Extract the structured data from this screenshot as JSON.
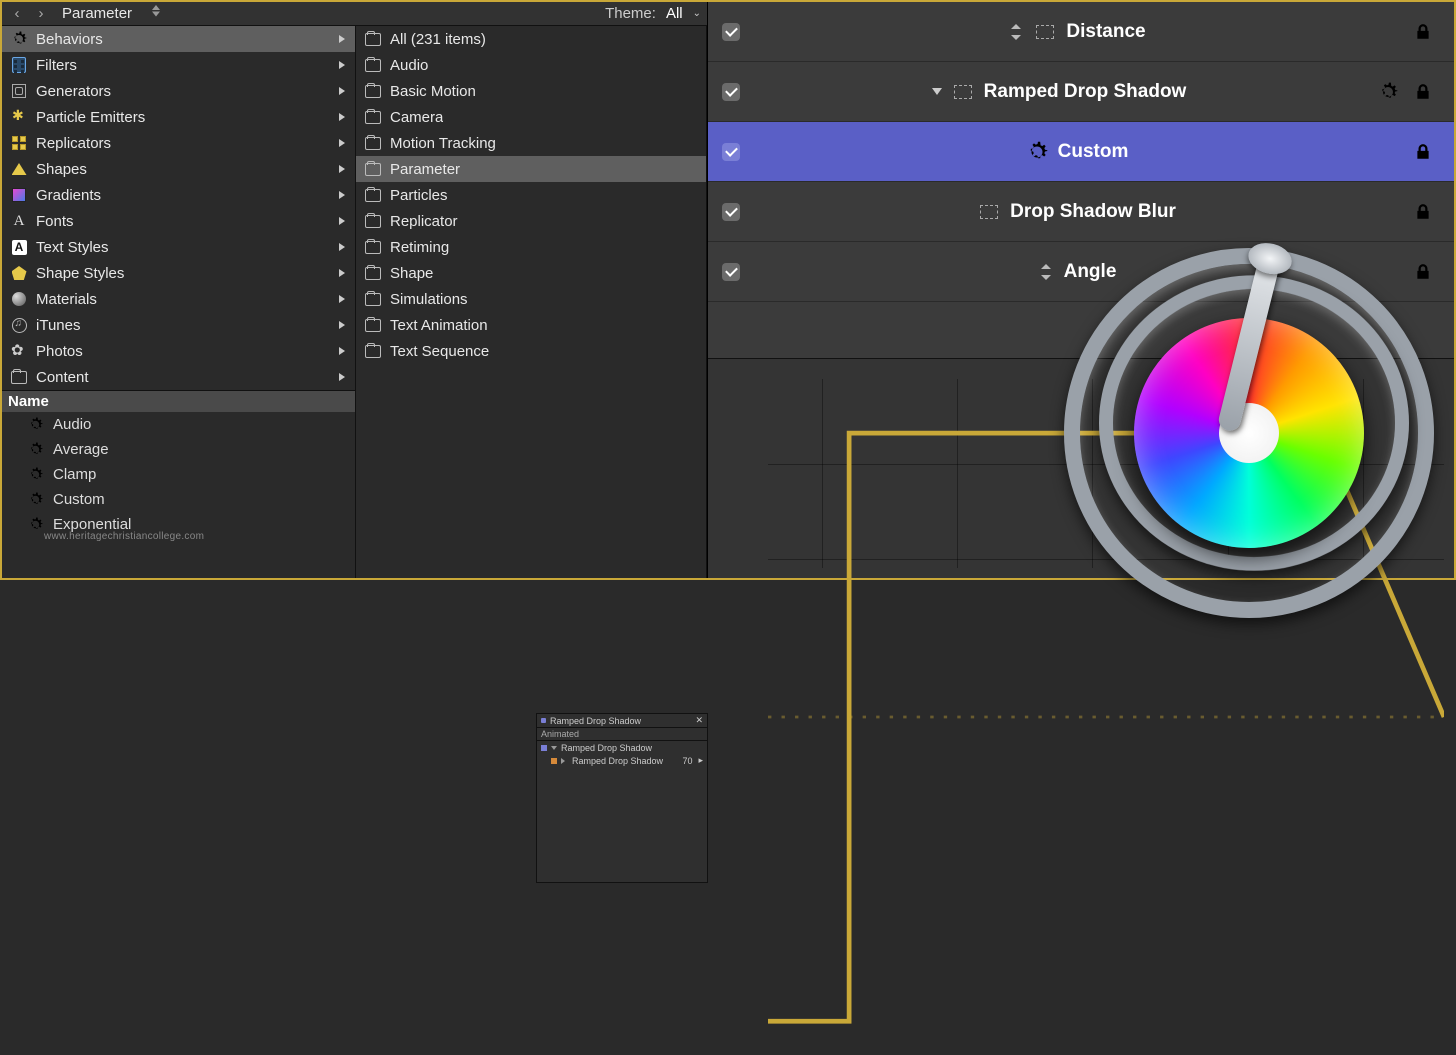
{
  "header": {
    "crumb": "Parameter",
    "theme_label": "Theme:",
    "theme_value": "All"
  },
  "categories": [
    {
      "label": "Behaviors",
      "icon": "gear",
      "selected": true
    },
    {
      "label": "Filters",
      "icon": "film"
    },
    {
      "label": "Generators",
      "icon": "gen"
    },
    {
      "label": "Particle Emitters",
      "icon": "particle"
    },
    {
      "label": "Replicators",
      "icon": "repl"
    },
    {
      "label": "Shapes",
      "icon": "shape"
    },
    {
      "label": "Gradients",
      "icon": "grad"
    },
    {
      "label": "Fonts",
      "icon": "font"
    },
    {
      "label": "Text Styles",
      "icon": "astyle"
    },
    {
      "label": "Shape Styles",
      "icon": "pent"
    },
    {
      "label": "Materials",
      "icon": "mat"
    },
    {
      "label": "iTunes",
      "icon": "itunes"
    },
    {
      "label": "Photos",
      "icon": "photos"
    },
    {
      "label": "Content",
      "icon": "folder"
    }
  ],
  "subcats": [
    {
      "label": "All (231 items)"
    },
    {
      "label": "Audio"
    },
    {
      "label": "Basic Motion"
    },
    {
      "label": "Camera"
    },
    {
      "label": "Motion Tracking"
    },
    {
      "label": "Parameter",
      "selected": true
    },
    {
      "label": "Particles"
    },
    {
      "label": "Replicator"
    },
    {
      "label": "Retiming"
    },
    {
      "label": "Shape"
    },
    {
      "label": "Simulations"
    },
    {
      "label": "Text Animation"
    },
    {
      "label": "Text Sequence"
    }
  ],
  "name_header": "Name",
  "behaviors_list": [
    "Audio",
    "Average",
    "Clamp",
    "Custom",
    "Exponential"
  ],
  "layers": [
    {
      "label": "Distance",
      "checked": true,
      "icon": "stepper",
      "thumb": "dashed"
    },
    {
      "label": "Ramped Drop Shadow",
      "checked": true,
      "icon": "disclose-down",
      "thumb": "dashed",
      "gear": true
    },
    {
      "label": "Custom",
      "checked": true,
      "selected": true,
      "icon": "gear"
    },
    {
      "label": "Drop Shadow Blur",
      "checked": true,
      "thumb": "dashed"
    },
    {
      "label": "Angle",
      "checked": true,
      "icon": "stepper"
    }
  ],
  "mini_editor": {
    "title": "Ramped Drop Shadow",
    "tab": "Animated",
    "group": "Ramped Drop Shadow",
    "param": "Ramped Drop Shadow",
    "value": "70"
  },
  "watermark": "www.heritagechristiancollege.com"
}
